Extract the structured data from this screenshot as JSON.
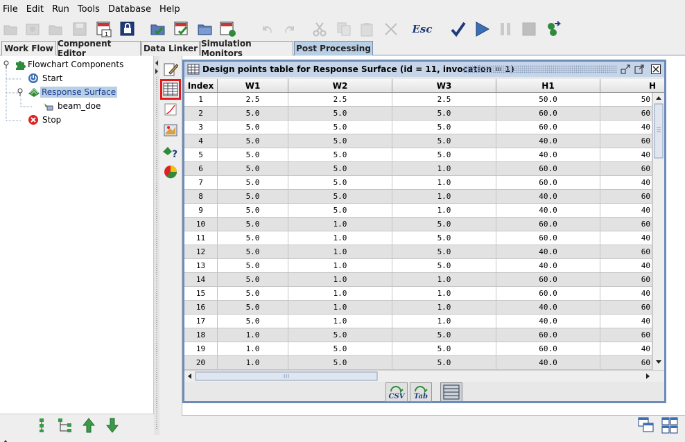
{
  "menu": [
    "File",
    "Edit",
    "Run",
    "Tools",
    "Database",
    "Help"
  ],
  "toolbar": {
    "esc_label": "Esc"
  },
  "tabs": [
    "Work Flow",
    "Component Editor",
    "Data Linker",
    "Simulation Monitors",
    "Post Processing"
  ],
  "active_tab": "Post Processing",
  "tree": {
    "root": "Flowchart Components",
    "start": "Start",
    "response_surface": "Response Surface",
    "beam_doe": "beam_doe",
    "stop": "Stop"
  },
  "frame": {
    "title": "Design points table for Response Surface (id = 11, invocation = 1)"
  },
  "table": {
    "columns": [
      "Index",
      "W1",
      "W2",
      "W3",
      "H1",
      "H"
    ],
    "rows": [
      [
        "1",
        "2.5",
        "2.5",
        "2.5",
        "50.0",
        "50"
      ],
      [
        "2",
        "5.0",
        "5.0",
        "5.0",
        "60.0",
        "60"
      ],
      [
        "3",
        "5.0",
        "5.0",
        "5.0",
        "60.0",
        "40"
      ],
      [
        "4",
        "5.0",
        "5.0",
        "5.0",
        "40.0",
        "60"
      ],
      [
        "5",
        "5.0",
        "5.0",
        "5.0",
        "40.0",
        "40"
      ],
      [
        "6",
        "5.0",
        "5.0",
        "1.0",
        "60.0",
        "60"
      ],
      [
        "7",
        "5.0",
        "5.0",
        "1.0",
        "60.0",
        "40"
      ],
      [
        "8",
        "5.0",
        "5.0",
        "1.0",
        "40.0",
        "60"
      ],
      [
        "9",
        "5.0",
        "5.0",
        "1.0",
        "40.0",
        "40"
      ],
      [
        "10",
        "5.0",
        "1.0",
        "5.0",
        "60.0",
        "60"
      ],
      [
        "11",
        "5.0",
        "1.0",
        "5.0",
        "60.0",
        "40"
      ],
      [
        "12",
        "5.0",
        "1.0",
        "5.0",
        "40.0",
        "60"
      ],
      [
        "13",
        "5.0",
        "1.0",
        "5.0",
        "40.0",
        "40"
      ],
      [
        "14",
        "5.0",
        "1.0",
        "1.0",
        "60.0",
        "60"
      ],
      [
        "15",
        "5.0",
        "1.0",
        "1.0",
        "60.0",
        "40"
      ],
      [
        "16",
        "5.0",
        "1.0",
        "1.0",
        "40.0",
        "60"
      ],
      [
        "17",
        "5.0",
        "1.0",
        "1.0",
        "40.0",
        "40"
      ],
      [
        "18",
        "1.0",
        "5.0",
        "5.0",
        "60.0",
        "60"
      ],
      [
        "19",
        "1.0",
        "5.0",
        "5.0",
        "60.0",
        "40"
      ],
      [
        "20",
        "1.0",
        "5.0",
        "5.0",
        "40.0",
        "60"
      ]
    ]
  },
  "export_buttons": {
    "csv": "CSV",
    "tab": "Tab"
  },
  "colors": {
    "highlight": "#e01b1b",
    "active_tab": "#b8cfe5",
    "frame_border": "#6d8bb8"
  }
}
